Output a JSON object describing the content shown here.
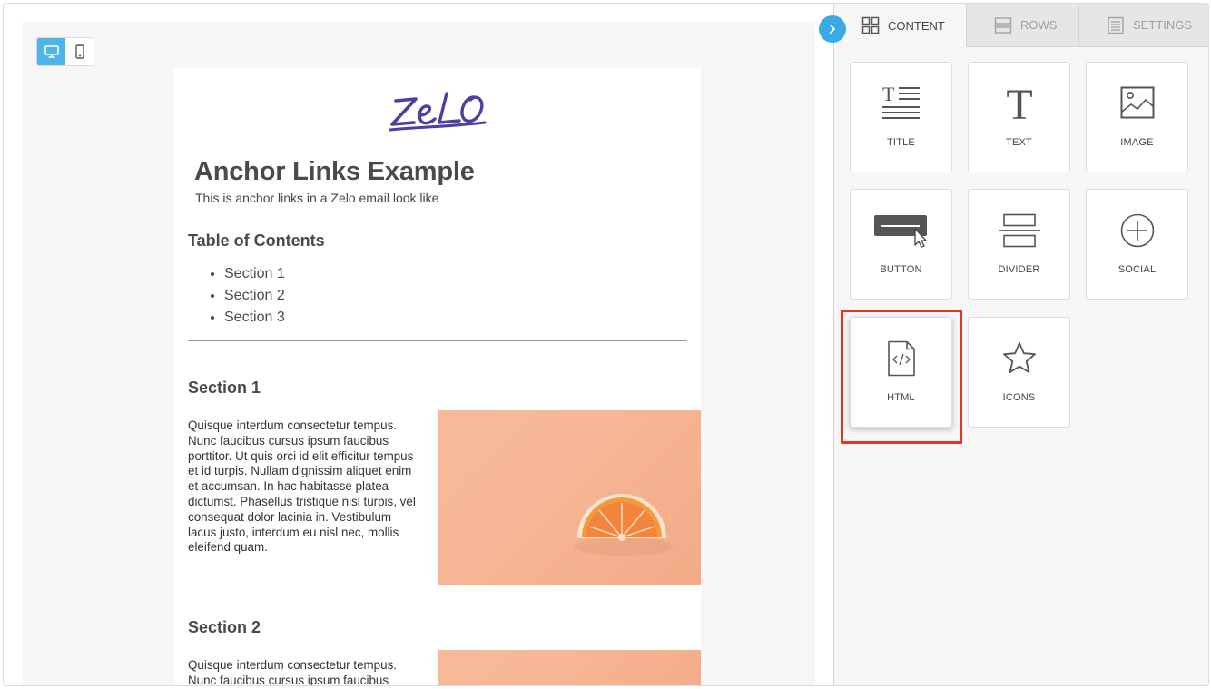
{
  "email": {
    "logo_text": "ZeLO",
    "title": "Anchor Links Example",
    "subtitle": "This is  anchor links in a Zelo email look like",
    "toc_heading": "Table of Contents",
    "toc_items": [
      "Section 1",
      "Section 2",
      "Section 3"
    ],
    "sections": [
      {
        "heading": "Section 1",
        "body": "Quisque interdum consectetur tempus. Nunc faucibus cursus ipsum faucibus porttitor. Ut quis orci id elit efficitur tempus et id turpis. Nullam dignissim aliquet enim et accumsan. In hac habitasse platea dictumst. Phasellus tristique nisl turpis, vel consequat dolor lacinia in. Vestibulum lacus justo, interdum eu nisl nec, mollis eleifend quam."
      },
      {
        "heading": "Section 2",
        "body": "Quisque interdum consectetur tempus. Nunc faucibus cursus ipsum faucibus porttitor. Ut quis orci id elit efficitur"
      }
    ]
  },
  "device_toggle": {
    "desktop_icon": "desktop-icon",
    "mobile_icon": "mobile-icon",
    "active": "desktop"
  },
  "panel": {
    "tabs": [
      {
        "label": "CONTENT",
        "icon": "grid-icon",
        "active": true
      },
      {
        "label": "ROWS",
        "icon": "rows-icon",
        "active": false
      },
      {
        "label": "SETTINGS",
        "icon": "settings-list-icon",
        "active": false
      }
    ],
    "tiles": [
      {
        "label": "TITLE",
        "icon": "title-icon"
      },
      {
        "label": "TEXT",
        "icon": "text-icon"
      },
      {
        "label": "IMAGE",
        "icon": "image-icon"
      },
      {
        "label": "BUTTON",
        "icon": "button-icon"
      },
      {
        "label": "DIVIDER",
        "icon": "divider-icon"
      },
      {
        "label": "SOCIAL",
        "icon": "social-icon"
      },
      {
        "label": "HTML",
        "icon": "html-file-icon"
      },
      {
        "label": "ICONS",
        "icon": "star-icon"
      }
    ]
  },
  "colors": {
    "accent": "#3aa9e4",
    "highlight": "#e8331f",
    "logo": "#4b3fa0",
    "heading": "#4a4a4a"
  }
}
